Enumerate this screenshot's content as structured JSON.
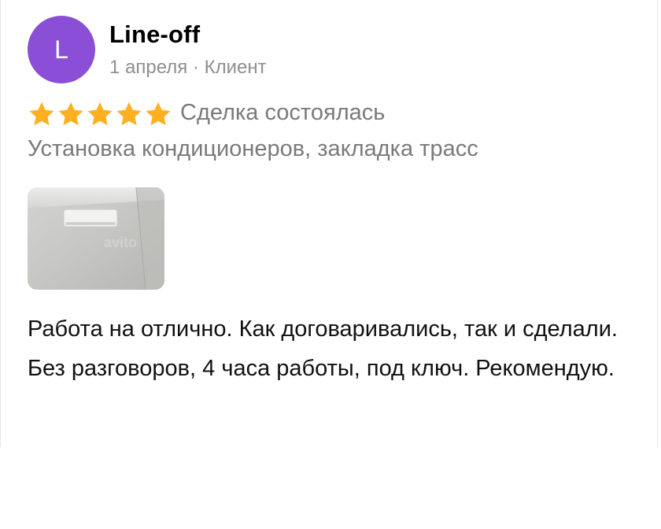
{
  "author": {
    "initial": "L",
    "name": "Line-off",
    "avatar_color": "#8a4fd6"
  },
  "review": {
    "meta": "1 апреля · Клиент",
    "rating": 5,
    "rating_max": 5,
    "star_color": "#ffb021",
    "status": "Сделка состоялась",
    "service": "Установка кондиционеров, закладка трасс",
    "photo_icon": "air-conditioner-photo",
    "text": "Работа на отлично. Как договаривались, так и сделали. Без разговоров, 4 часа работы, под ключ. Рекомендую."
  }
}
